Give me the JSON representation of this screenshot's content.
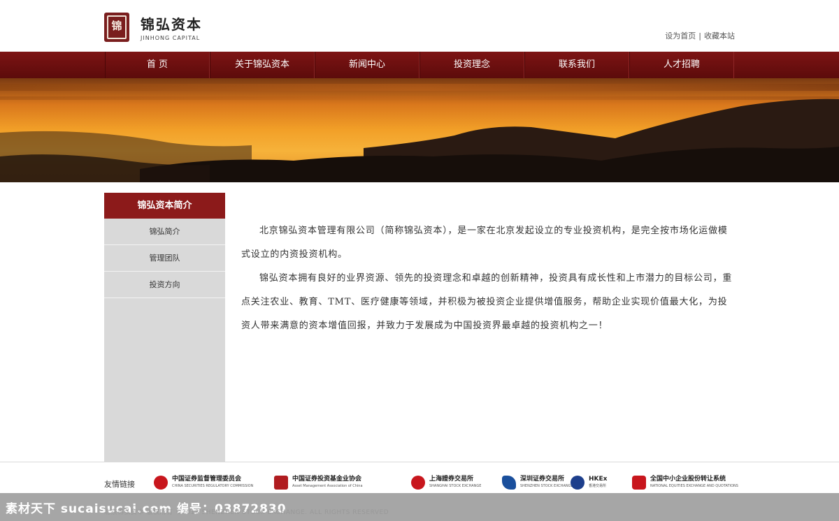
{
  "brand": {
    "seal_char": "锦",
    "name_cn": "锦弘资本",
    "name_en": "JINHONG  CAPITAL"
  },
  "top_links": {
    "set_home": "设为首页",
    "separator": "|",
    "bookmark": "收藏本站"
  },
  "nav": {
    "items": [
      {
        "label": "首 页"
      },
      {
        "label": "关于锦弘资本"
      },
      {
        "label": "新闻中心"
      },
      {
        "label": "投资理念"
      },
      {
        "label": "联系我们"
      },
      {
        "label": "人才招聘"
      }
    ]
  },
  "sidebar": {
    "title": "锦弘资本简介",
    "items": [
      {
        "label": "锦弘简介"
      },
      {
        "label": "管理团队"
      },
      {
        "label": "投资方向"
      }
    ]
  },
  "main": {
    "paragraphs": [
      "北京锦弘资本管理有限公司（简称锦弘资本），是一家在北京发起设立的专业投资机构，是完全按市场化运做模式设立的内资投资机构。",
      "锦弘资本拥有良好的业界资源、领先的投资理念和卓越的创新精神，投资具有成长性和上市潜力的目标公司，重点关注农业、教育、TMT、医疗健康等领域，并积极为被投资企业提供增值服务，帮助企业实现价值最大化，为投资人带来满意的资本增值回报，并致力于发展成为中国投资界最卓越的投资机构之一！"
    ]
  },
  "footer": {
    "links_label": "友情链接",
    "partners": [
      {
        "name": "中国证券监督管理委员会",
        "sub": "CHINA SECURITIES REGULATORY COMMISSION",
        "color": "#c8161d"
      },
      {
        "name": "中国证券投资基金业协会",
        "sub": "Asset Management Association of China",
        "color": "#b01c20"
      },
      {
        "name": "上海證券交易所",
        "sub": "SHANGHAI STOCK EXCHANGE",
        "color": "#c8161d"
      },
      {
        "name": "深圳证券交易所",
        "sub": "SHENZHEN STOCK EXCHANGE",
        "color": "#1a4f9c"
      },
      {
        "name": "HKEx",
        "sub": "香港交易所",
        "color": "#1d3f8c"
      },
      {
        "name": "全国中小企业股份转让系统",
        "sub": "NATIONAL EQUITIES EXCHANGE AND QUOTATIONS",
        "color": "#c8161d"
      }
    ],
    "copyright": "北京锦弘资本 版权所有 ©2013 SHENZHEN STOCK EXCHANGE. ALL RIGHTS RESERVED"
  },
  "watermark": {
    "text": "素材天下 sucaisucai.com  编号：03872830"
  },
  "colors": {
    "nav_bg": "#6e1010",
    "accent": "#8c1a1a",
    "sidebar_bg": "#d9d9d9"
  }
}
